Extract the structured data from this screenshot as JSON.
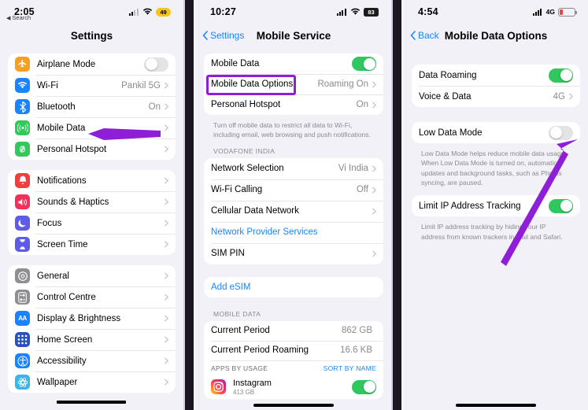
{
  "panels": {
    "left": {
      "status": {
        "time": "2:05",
        "back_label": "Search",
        "battery": "49",
        "battery_style": "low-power-yellow"
      },
      "nav_title": "Settings",
      "groups": [
        {
          "rows": [
            {
              "icon": "airplane-icon",
              "icon_color": "#f5a020",
              "label": "Airplane Mode",
              "control": "toggle-off"
            },
            {
              "icon": "wifi-icon",
              "icon_color": "#1a84ff",
              "label": "Wi-Fi",
              "value": "Pankil 5G",
              "control": "chevron"
            },
            {
              "icon": "bluetooth-icon",
              "icon_color": "#1a84ff",
              "label": "Bluetooth",
              "value": "On",
              "control": "chevron"
            },
            {
              "icon": "mobile-data-icon",
              "icon_color": "#34c759",
              "label": "Mobile Data",
              "value": "",
              "control": "chevron"
            },
            {
              "icon": "personal-hotspot-icon",
              "icon_color": "#34c759",
              "label": "Personal Hotspot",
              "value": "",
              "control": "chevron"
            }
          ]
        },
        {
          "rows": [
            {
              "icon": "notifications-icon",
              "icon_color": "#f03e3e",
              "label": "Notifications",
              "value": "",
              "control": "chevron"
            },
            {
              "icon": "sounds-haptics-icon",
              "icon_color": "#f2315a",
              "label": "Sounds & Haptics",
              "value": "",
              "control": "chevron"
            },
            {
              "icon": "focus-icon",
              "icon_color": "#5e5ce6",
              "label": "Focus",
              "value": "",
              "control": "chevron"
            },
            {
              "icon": "screen-time-icon",
              "icon_color": "#5e5ce6",
              "label": "Screen Time",
              "value": "",
              "control": "chevron"
            }
          ]
        },
        {
          "rows": [
            {
              "icon": "general-gear-icon",
              "icon_color": "#8e8e93",
              "label": "General",
              "value": "",
              "control": "chevron"
            },
            {
              "icon": "control-centre-icon",
              "icon_color": "#8e8e93",
              "label": "Control Centre",
              "value": "",
              "control": "chevron"
            },
            {
              "icon": "display-brightness-icon",
              "icon_color": "#1a84ff",
              "label": "Display & Brightness",
              "value": "",
              "control": "chevron"
            },
            {
              "icon": "home-screen-icon",
              "icon_color": "#2a52be",
              "label": "Home Screen",
              "value": "",
              "control": "chevron"
            },
            {
              "icon": "accessibility-icon",
              "icon_color": "#1a84ff",
              "label": "Accessibility",
              "value": "",
              "control": "chevron"
            },
            {
              "icon": "wallpaper-icon",
              "icon_color": "#3ab7e8",
              "label": "Wallpaper",
              "value": "",
              "control": "chevron"
            }
          ]
        }
      ]
    },
    "middle": {
      "status": {
        "time": "10:27",
        "battery": "83",
        "battery_style": "dark-pill"
      },
      "nav_back": "Settings",
      "nav_title": "Mobile Service",
      "group1": [
        {
          "label": "Mobile Data",
          "control": "toggle-on"
        },
        {
          "label": "Mobile Data Options",
          "value": "Roaming On",
          "control": "chevron",
          "highlighted": true
        },
        {
          "label": "Personal Hotspot",
          "value": "On",
          "control": "chevron"
        }
      ],
      "footnote1": "Turn off mobile data to restrict all data to Wi-Fi, including email, web browsing and push notifications.",
      "section2_header": "VODAFONE INDIA",
      "group2": [
        {
          "label": "Network Selection",
          "value": "Vi India",
          "control": "chevron"
        },
        {
          "label": "Wi-Fi Calling",
          "value": "Off",
          "control": "chevron"
        },
        {
          "label": "Cellular Data Network",
          "value": "",
          "control": "chevron"
        },
        {
          "label": "Network Provider Services",
          "value": "",
          "control": "none",
          "link": true
        },
        {
          "label": "SIM PIN",
          "value": "",
          "control": "chevron"
        }
      ],
      "group3": [
        {
          "label": "Add eSIM",
          "value": "",
          "control": "none",
          "link": true
        }
      ],
      "section4_header": "MOBILE DATA",
      "group4": [
        {
          "label": "Current Period",
          "value": "862 GB",
          "control": "none"
        },
        {
          "label": "Current Period Roaming",
          "value": "16.6 KB",
          "control": "none"
        }
      ],
      "usage_head": {
        "left": "APPS BY USAGE",
        "right": "SORT BY NAME"
      },
      "apps": [
        {
          "icon": "instagram-icon",
          "name": "Instagram",
          "size": "413 GB",
          "control": "toggle-on"
        }
      ]
    },
    "right": {
      "status": {
        "time": "4:54",
        "network": "4G",
        "battery_style": "low-red-shell"
      },
      "nav_back": "Back",
      "nav_title": "Mobile Data Options",
      "group1": [
        {
          "label": "Data Roaming",
          "control": "toggle-on"
        },
        {
          "label": "Voice & Data",
          "value": "4G",
          "control": "chevron"
        }
      ],
      "group2": [
        {
          "label": "Low Data Mode",
          "control": "toggle-off"
        }
      ],
      "footnote2": "Low Data Mode helps reduce mobile data usage. When Low Data Mode is turned on, automatic updates and background tasks, such as Photos syncing, are paused.",
      "group3": [
        {
          "label": "Limit IP Address Tracking",
          "control": "toggle-on"
        }
      ],
      "footnote3": "Limit IP address tracking by hiding your IP address from known trackers in Mail and Safari."
    }
  },
  "annotations": {
    "arrow_color": "#8e1fd6",
    "highlight_color": "#8e1fd6",
    "arrow_left_target": "Mobile Data row",
    "arrow_right_target": "Low Data Mode toggle",
    "highlight_target": "Mobile Data Options row"
  }
}
